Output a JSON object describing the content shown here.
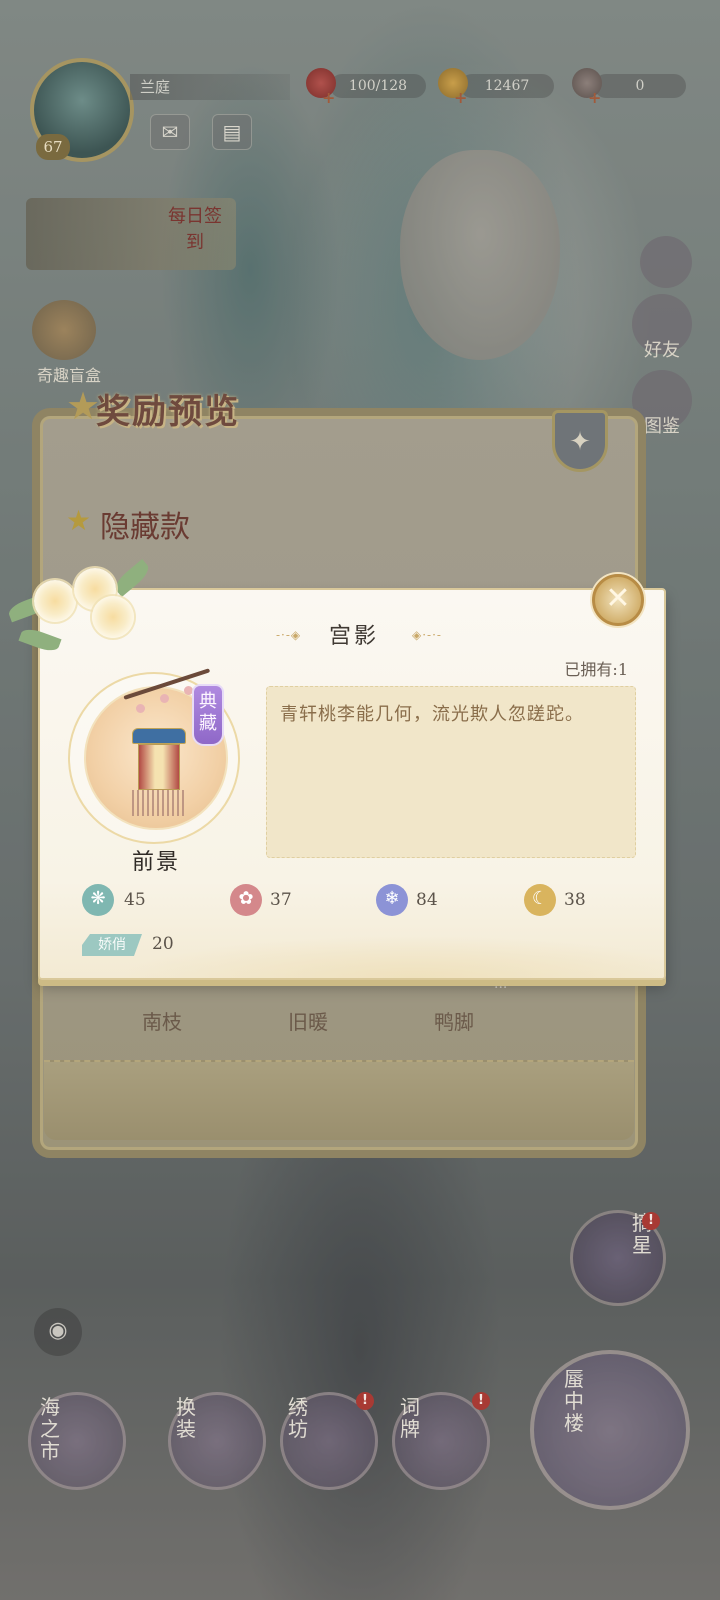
{
  "topbar": {
    "player_name": "兰庭",
    "level": "67",
    "stamina": "100/128",
    "gold": "12467",
    "gems": "0",
    "plus": "+"
  },
  "left_side": {
    "daily_signin": "每日签到",
    "blind_box": "奇趣盲盒"
  },
  "right_side": {
    "friends": "好友",
    "gallery": "图鉴"
  },
  "reward_panel": {
    "title": "奖励预览",
    "section_hidden": "隐藏款",
    "characters": [
      "南枝",
      "旧暖",
      "鸭脚"
    ]
  },
  "modal": {
    "title": "宫影",
    "title_deco_left": "-·-◈",
    "title_deco_right": "◈·-·-",
    "owned": "已拥有:1",
    "rarity": "典藏",
    "item_type": "前景",
    "description": "青轩桃李能几何，流光欺人忽蹉跎。",
    "close_symbol": "✕",
    "stats": [
      {
        "icon": "swirl-icon",
        "value": "45",
        "color": "#7fb7b1"
      },
      {
        "icon": "lotus-icon",
        "value": "37",
        "color": "#d4888b"
      },
      {
        "icon": "snowflake-icon",
        "value": "84",
        "color": "#8c93d6"
      },
      {
        "icon": "moon-icon",
        "value": "38",
        "color": "#d9b45e"
      }
    ],
    "trait_label": "娇俏",
    "trait_value": "20"
  },
  "bottom_nav": {
    "sea_market": "海之市",
    "dress_up": "换装",
    "embroidery": "绣坊",
    "ci_cards": "词牌",
    "mirage_tower": "蜃中楼",
    "pick_star": "摘星",
    "alert": "!"
  },
  "more_indicator": "..."
}
